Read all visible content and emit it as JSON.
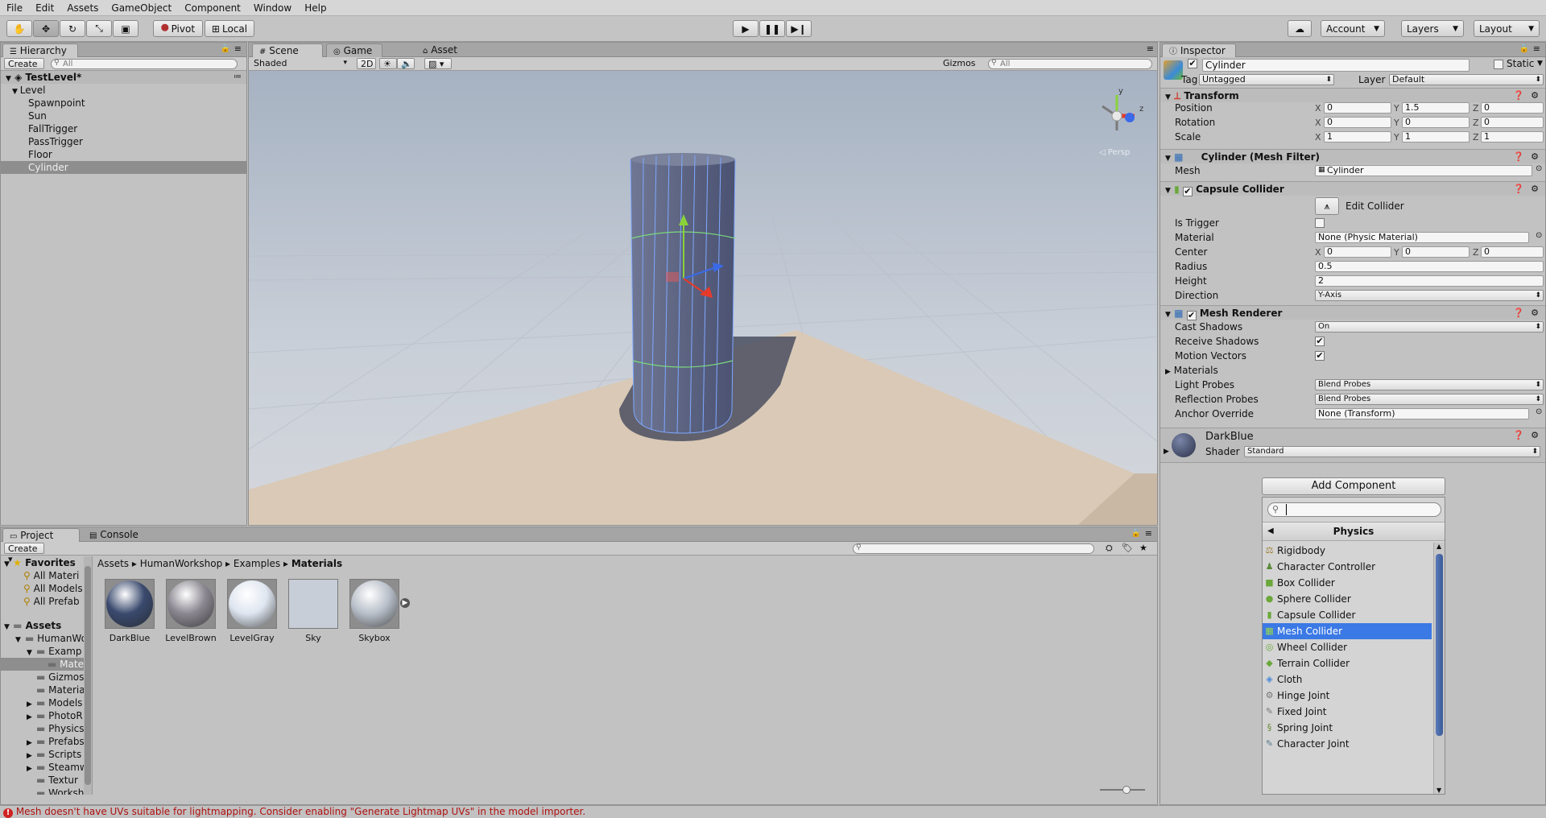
{
  "menu": [
    "File",
    "Edit",
    "Assets",
    "GameObject",
    "Component",
    "Window",
    "Help"
  ],
  "toolbar": {
    "pivot": "Pivot",
    "local": "Local",
    "account": "Account",
    "layers": "Layers",
    "layout": "Layout"
  },
  "hierarchy": {
    "tab": "Hierarchy",
    "create": "Create",
    "search_placeholder": "All",
    "scene": "TestLevel*",
    "items": [
      {
        "label": "Level",
        "depth": 1,
        "expanded": true
      },
      {
        "label": "Spawnpoint",
        "depth": 2
      },
      {
        "label": "Sun",
        "depth": 2
      },
      {
        "label": "FallTrigger",
        "depth": 2
      },
      {
        "label": "PassTrigger",
        "depth": 2
      },
      {
        "label": "Floor",
        "depth": 2
      },
      {
        "label": "Cylinder",
        "depth": 2,
        "selected": true
      }
    ]
  },
  "scene": {
    "tabs": [
      "Scene",
      "Game",
      "Asset Store"
    ],
    "shading": "Shaded",
    "mode2d": "2D",
    "gizmos": "Gizmos",
    "search_placeholder": "All",
    "persp": "◁ Persp",
    "gizmo_axes": {
      "y": "y",
      "z": "z"
    }
  },
  "inspector": {
    "tab": "Inspector",
    "name": "Cylinder",
    "static_label": "Static",
    "tag_label": "Tag",
    "tag": "Untagged",
    "layer_label": "Layer",
    "layer": "Default",
    "transform": {
      "title": "Transform",
      "rows": [
        {
          "label": "Position",
          "x": "0",
          "y": "1.5",
          "z": "0"
        },
        {
          "label": "Rotation",
          "x": "0",
          "y": "0",
          "z": "0"
        },
        {
          "label": "Scale",
          "x": "1",
          "y": "1",
          "z": "1"
        }
      ]
    },
    "axis": {
      "x": "X",
      "y": "Y",
      "z": "Z"
    },
    "meshfilter": {
      "title": "Cylinder (Mesh Filter)",
      "mesh_label": "Mesh",
      "mesh": "Cylinder"
    },
    "collider": {
      "title": "Capsule Collider",
      "edit": "Edit Collider",
      "is_trigger": "Is Trigger",
      "material_label": "Material",
      "material": "None (Physic Material)",
      "center_label": "Center",
      "center": {
        "x": "0",
        "y": "0",
        "z": "0"
      },
      "radius_label": "Radius",
      "radius": "0.5",
      "height_label": "Height",
      "height": "2",
      "direction_label": "Direction",
      "direction": "Y-Axis"
    },
    "renderer": {
      "title": "Mesh Renderer",
      "cast_label": "Cast Shadows",
      "cast": "On",
      "receive": "Receive Shadows",
      "motion": "Motion Vectors",
      "materials": "Materials",
      "light_label": "Light Probes",
      "light": "Blend Probes",
      "refl_label": "Reflection Probes",
      "refl": "Blend Probes",
      "anchor_label": "Anchor Override",
      "anchor": "None (Transform)"
    },
    "material": {
      "name": "DarkBlue",
      "shader_label": "Shader",
      "shader": "Standard"
    },
    "add_component": "Add Component"
  },
  "add_popup": {
    "search_value": "",
    "title": "Physics",
    "items": [
      {
        "label": "Rigidbody",
        "icon": "rigidbody-icon",
        "glyph": "⚖",
        "color": "#9a7a2a"
      },
      {
        "label": "Character Controller",
        "icon": "character-controller-icon",
        "glyph": "♟",
        "color": "#5a8a3a"
      },
      {
        "label": "Box Collider",
        "icon": "box-collider-icon",
        "glyph": "■",
        "color": "#6aa83a"
      },
      {
        "label": "Sphere Collider",
        "icon": "sphere-collider-icon",
        "glyph": "●",
        "color": "#6aa83a"
      },
      {
        "label": "Capsule Collider",
        "icon": "capsule-collider-icon",
        "glyph": "▮",
        "color": "#6aa83a"
      },
      {
        "label": "Mesh Collider",
        "icon": "mesh-collider-icon",
        "glyph": "▦",
        "color": "#9ad84a",
        "selected": true
      },
      {
        "label": "Wheel Collider",
        "icon": "wheel-collider-icon",
        "glyph": "◎",
        "color": "#6aa83a"
      },
      {
        "label": "Terrain Collider",
        "icon": "terrain-collider-icon",
        "glyph": "◆",
        "color": "#6aa83a"
      },
      {
        "label": "Cloth",
        "icon": "cloth-icon",
        "glyph": "◈",
        "color": "#4a8ad8"
      },
      {
        "label": "Hinge Joint",
        "icon": "hinge-joint-icon",
        "glyph": "⚙",
        "color": "#777"
      },
      {
        "label": "Fixed Joint",
        "icon": "fixed-joint-icon",
        "glyph": "✎",
        "color": "#777"
      },
      {
        "label": "Spring Joint",
        "icon": "spring-joint-icon",
        "glyph": "§",
        "color": "#6a8a3a"
      },
      {
        "label": "Character Joint",
        "icon": "character-joint-icon",
        "glyph": "✎",
        "color": "#5a7a8a"
      }
    ]
  },
  "project": {
    "tabs": [
      "Project",
      "Console"
    ],
    "create": "Create",
    "breadcrumb": [
      "Assets",
      "HumanWorkshop",
      "Examples",
      "Materials"
    ],
    "favorites_title": "Favorites",
    "favorites": [
      "All Materi",
      "All Models",
      "All Prefab"
    ],
    "assets_title": "Assets",
    "tree": [
      {
        "label": "HumanWo",
        "depth": 1,
        "arrow": "▼"
      },
      {
        "label": "Examp",
        "depth": 2,
        "arrow": "▼"
      },
      {
        "label": "Mate",
        "depth": 3,
        "arrow": "",
        "selected": true
      },
      {
        "label": "Gizmos",
        "depth": 2,
        "arrow": ""
      },
      {
        "label": "Materia",
        "depth": 2,
        "arrow": ""
      },
      {
        "label": "Models",
        "depth": 2,
        "arrow": "▶"
      },
      {
        "label": "PhotoR",
        "depth": 2,
        "arrow": "▶"
      },
      {
        "label": "Physics",
        "depth": 2,
        "arrow": ""
      },
      {
        "label": "Prefabs",
        "depth": 2,
        "arrow": "▶"
      },
      {
        "label": "Scripts",
        "depth": 2,
        "arrow": "▶"
      },
      {
        "label": "Steamw",
        "depth": 2,
        "arrow": "▶"
      },
      {
        "label": "Textur",
        "depth": 2,
        "arrow": ""
      },
      {
        "label": "Worksh",
        "depth": 2,
        "arrow": ""
      }
    ],
    "assets": [
      {
        "label": "DarkBlue",
        "color": "#3a4a6e"
      },
      {
        "label": "LevelBrown",
        "color": "#8a8790"
      },
      {
        "label": "LevelGray",
        "color": "#dfe6f0"
      },
      {
        "label": "Sky",
        "color": "#c7ced8"
      },
      {
        "label": "Skybox",
        "color": "#b9c0ca"
      }
    ]
  },
  "status": "Mesh doesn't have UVs suitable for lightmapping. Consider enabling \"Generate Lightmap UVs\" in the model importer."
}
